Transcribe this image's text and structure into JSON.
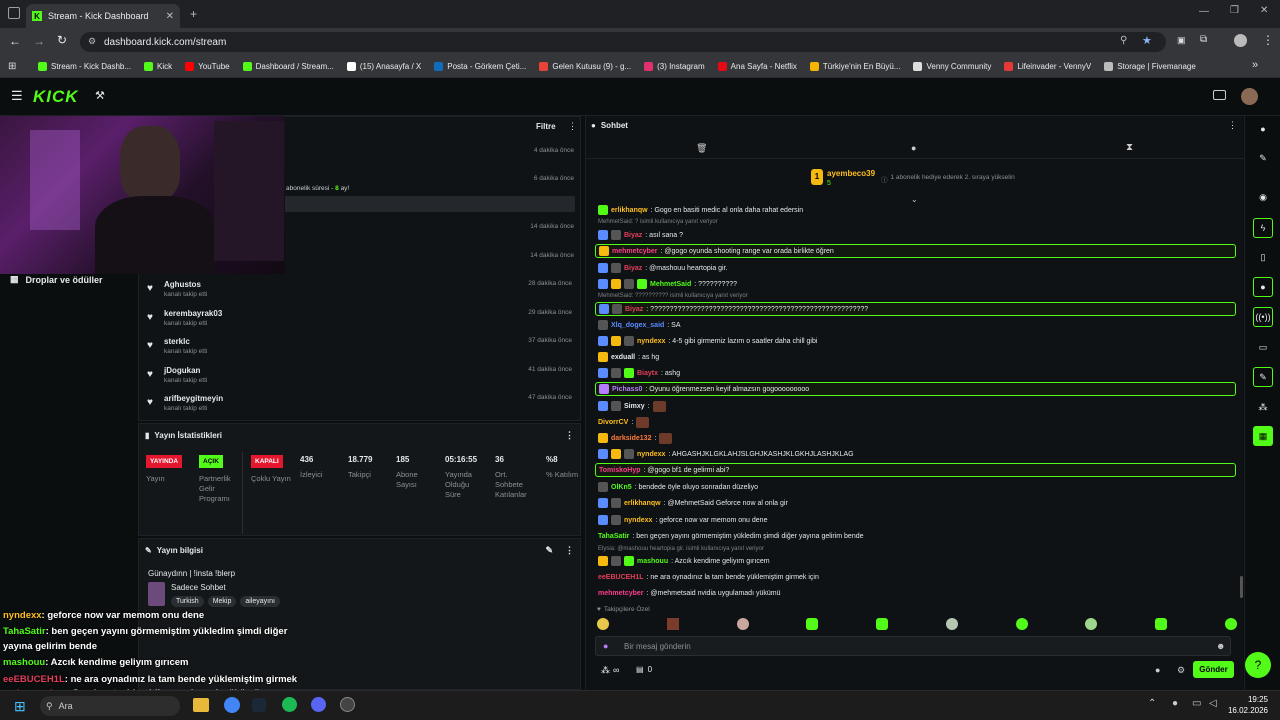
{
  "browser": {
    "tab_title": "Stream - Kick Dashboard",
    "url": "dashboard.kick.com/stream",
    "bookmarks": [
      {
        "label": "Stream - Kick Dashb...",
        "color": "#53fc18"
      },
      {
        "label": "Kick",
        "color": "#53fc18"
      },
      {
        "label": "YouTube",
        "color": "#ff0000"
      },
      {
        "label": "Dashboard / Stream...",
        "color": "#53fc18"
      },
      {
        "label": "(15) Anasayfa / X",
        "color": "#ffffff"
      },
      {
        "label": "Posta - Görkem Çeti...",
        "color": "#0f6cbd"
      },
      {
        "label": "Gelen Kutusu (9) - g...",
        "color": "#ea4335"
      },
      {
        "label": "(3) Instagram",
        "color": "#e1306c"
      },
      {
        "label": "Ana Sayfa - Netflix",
        "color": "#e50914"
      },
      {
        "label": "Türkiye'nin En Büyü...",
        "color": "#f4b400"
      },
      {
        "label": "Venny Community",
        "color": "#dddddd"
      },
      {
        "label": "Lifeinvader - VennyV",
        "color": "#e53935"
      },
      {
        "label": "Storage | Fivemanage",
        "color": "#bbbbbb"
      }
    ]
  },
  "left": {
    "drops_label": "Droplar ve ödüller"
  },
  "activity": {
    "filter_label": "Filtre",
    "sub_text": "abonelik süresi - ",
    "sub_months": "8",
    "sub_suffix": " ay!",
    "times_top": [
      "4 dakika önce",
      "6 dakika önce",
      "14 dakika önce",
      "14 dakika önce"
    ],
    "follows": [
      {
        "name": "Aghustos",
        "sub": "kanalı takip etti",
        "time": "28 dakika önce"
      },
      {
        "name": "kerembayrak03",
        "sub": "kanalı takip etti",
        "time": "29 dakika önce"
      },
      {
        "name": "sterklc",
        "sub": "kanalı takip etti",
        "time": "37 dakika önce"
      },
      {
        "name": "jDogukan",
        "sub": "kanalı takip etti",
        "time": "41 dakika önce"
      },
      {
        "name": "arifbeygitmeyin",
        "sub": "kanalı takip etti",
        "time": "47 dakika önce"
      }
    ]
  },
  "stats": {
    "title": "Yayın İstatistikleri",
    "yayin_badge": "YAYINDA",
    "yayin_label": "Yayın",
    "partner_badge": "AÇIK",
    "partner_label": "Partnerlik Gelir Programı",
    "multi_badge": "KAPALI",
    "multi_label": "Çoklu Yayın",
    "items": [
      {
        "value": "436",
        "label": "İzleyici"
      },
      {
        "value": "18.779",
        "label": "Takipçi"
      },
      {
        "value": "185",
        "label": "Abone Sayısı"
      },
      {
        "value": "05:16:55",
        "label": "Yayında Olduğu Süre"
      },
      {
        "value": "36",
        "label": "Ort. Sohbete Katılanlar"
      },
      {
        "value": "%8",
        "label": "% Katılım"
      }
    ]
  },
  "info": {
    "title": "Yayın bilgisi",
    "stream_title": "Günaydınn | !insta !blerp",
    "category": "Sadece Sohbet",
    "tags": [
      "Turkish",
      "Mekip",
      "aileyayını"
    ]
  },
  "chat": {
    "title": "Sohbet",
    "gift_user": "ayembeco39",
    "gift_count": "5",
    "gift_rank": "1",
    "gift_text": "1 abonelik hediye ederek 2. sıraya yükselin",
    "messages": [
      {
        "user": "erlikhanqw",
        "color": "#ffbf1f",
        "text": ": Gogo en basiti medic al onla daha rahat edersin",
        "hl": false
      },
      {
        "reply": "MehmetSaid: ? isimli kullanıcıya yanıt veriyor"
      },
      {
        "user": "Biyaz",
        "color": "#e33e5b",
        "text": ": asıl sana ?",
        "hl": false
      },
      {
        "user": "mehmetcyber",
        "color": "#ff3c8e",
        "text": ": @gogo oyunda shooting range var orada birlikte öğren",
        "hl": true
      },
      {
        "user": "Biyaz",
        "color": "#e33e5b",
        "text": ": @mashouu heartopia gir.",
        "hl": false
      },
      {
        "user": "MehmetSaid",
        "color": "#53fc18",
        "text": ": ??????????",
        "hl": false
      },
      {
        "reply": "MehmetSaid: ?????????? isimli kullanıcıya yanıt veriyor"
      },
      {
        "user": "Biyaz",
        "color": "#e33e5b",
        "text": ": ????????????????????????????????????????????????????????",
        "hl": true
      },
      {
        "user": "Xlq_dogex_said",
        "color": "#5a8bff",
        "text": ": SA",
        "hl": false
      },
      {
        "user": "nyndexx",
        "color": "#ffbf1f",
        "text": ": 4-5 gibi girmemiz lazım o saatler daha chill gibi",
        "hl": false
      },
      {
        "user": "exduall",
        "color": "#e6e9ec",
        "text": ": as hg",
        "hl": false
      },
      {
        "user": "Biaytx",
        "color": "#e33e5b",
        "text": ": ashg",
        "hl": false
      },
      {
        "user": "Pichass0",
        "color": "#b87cff",
        "text": ": Oyunu öğrenmezsen keyif almazsın gogooooooooo",
        "hl": true
      },
      {
        "user": "Simxy",
        "color": "#e6e9ec",
        "text": ":",
        "hl": false,
        "emote": true
      },
      {
        "user": "DivorrCV",
        "color": "#ffbf1f",
        "text": ":",
        "hl": false,
        "emote": true
      },
      {
        "user": "darkside132",
        "color": "#ff7a3c",
        "text": ":",
        "hl": false,
        "emote": true
      },
      {
        "user": "nyndexx",
        "color": "#ffbf1f",
        "text": ": AHGASHJKLGKLAHJSLGHJKASHJKLGKHJLASHJKLAG",
        "hl": false
      },
      {
        "user": "TomiskoHyp",
        "color": "#ff3c8e",
        "text": ": @gogo bf1 de gelirmi abi?",
        "hl": true
      },
      {
        "user": "OlKn5",
        "color": "#53fc18",
        "text": ": bendede öyle oluyo sonradan düzeliyo",
        "hl": false
      },
      {
        "user": "erlikhanqw",
        "color": "#ffbf1f",
        "text": ": @MehmetSaid Geforce now al onla gir",
        "hl": false
      },
      {
        "user": "nyndexx",
        "color": "#ffbf1f",
        "text": ": geforce now var memom onu dene",
        "hl": false
      },
      {
        "user": "TahaSatir",
        "color": "#53fc18",
        "text": ": ben geçen yayını görmemiştim yükledim şimdi diğer yayına gelirim bende",
        "hl": false
      },
      {
        "reply": "Elysia: @mashouu heartopia gir. isimli kullanıcıya yanıt veriyor"
      },
      {
        "user": "mashouu",
        "color": "#53fc18",
        "text": ": Azcık kendime geliyım gırıcem",
        "hl": false
      },
      {
        "user": "eeEBUCEH1L",
        "color": "#e33e5b",
        "text": ": ne ara oynadınız la tam bende yüklemiştim girmek için",
        "hl": false
      },
      {
        "user": "mehmetcyber",
        "color": "#ff3c8e",
        "text": ": @mehmetsaid nvidia uygulamadı yükümü",
        "hl": false
      }
    ],
    "followers_only": "Takipçilere Özel",
    "input_placeholder": "Bir mesaj gönderin",
    "send_label": "Gönder",
    "infinity": "∞",
    "zero": "0"
  },
  "overlay": [
    {
      "user": "nyndexx",
      "color": "#ffbf1f",
      "text": ": geforce now var memom onu dene"
    },
    {
      "user": "TahaSatir",
      "color": "#53fc18",
      "text": ": ben geçen yayını görmemiştim yükledim şimdi diğer"
    },
    {
      "user": "",
      "color": "#ffffff",
      "text": "yayına gelirim bende"
    },
    {
      "user": "mashouu",
      "color": "#53fc18",
      "text": ": Azcık kendime geliyım gırıcem"
    },
    {
      "user": "eeEBUCEH1L",
      "color": "#e33e5b",
      "text": ": ne ara oynadınız la tam bende yüklemiştim girmek"
    },
    {
      "user": "mehmetcyber",
      "color": "#ff3c8e",
      "text": ": @mehmetsaid nvidia uygulamadı yükümü"
    }
  ],
  "taskbar": {
    "search_label": "Ara",
    "time": "19:25",
    "date": "16.02.2026"
  }
}
